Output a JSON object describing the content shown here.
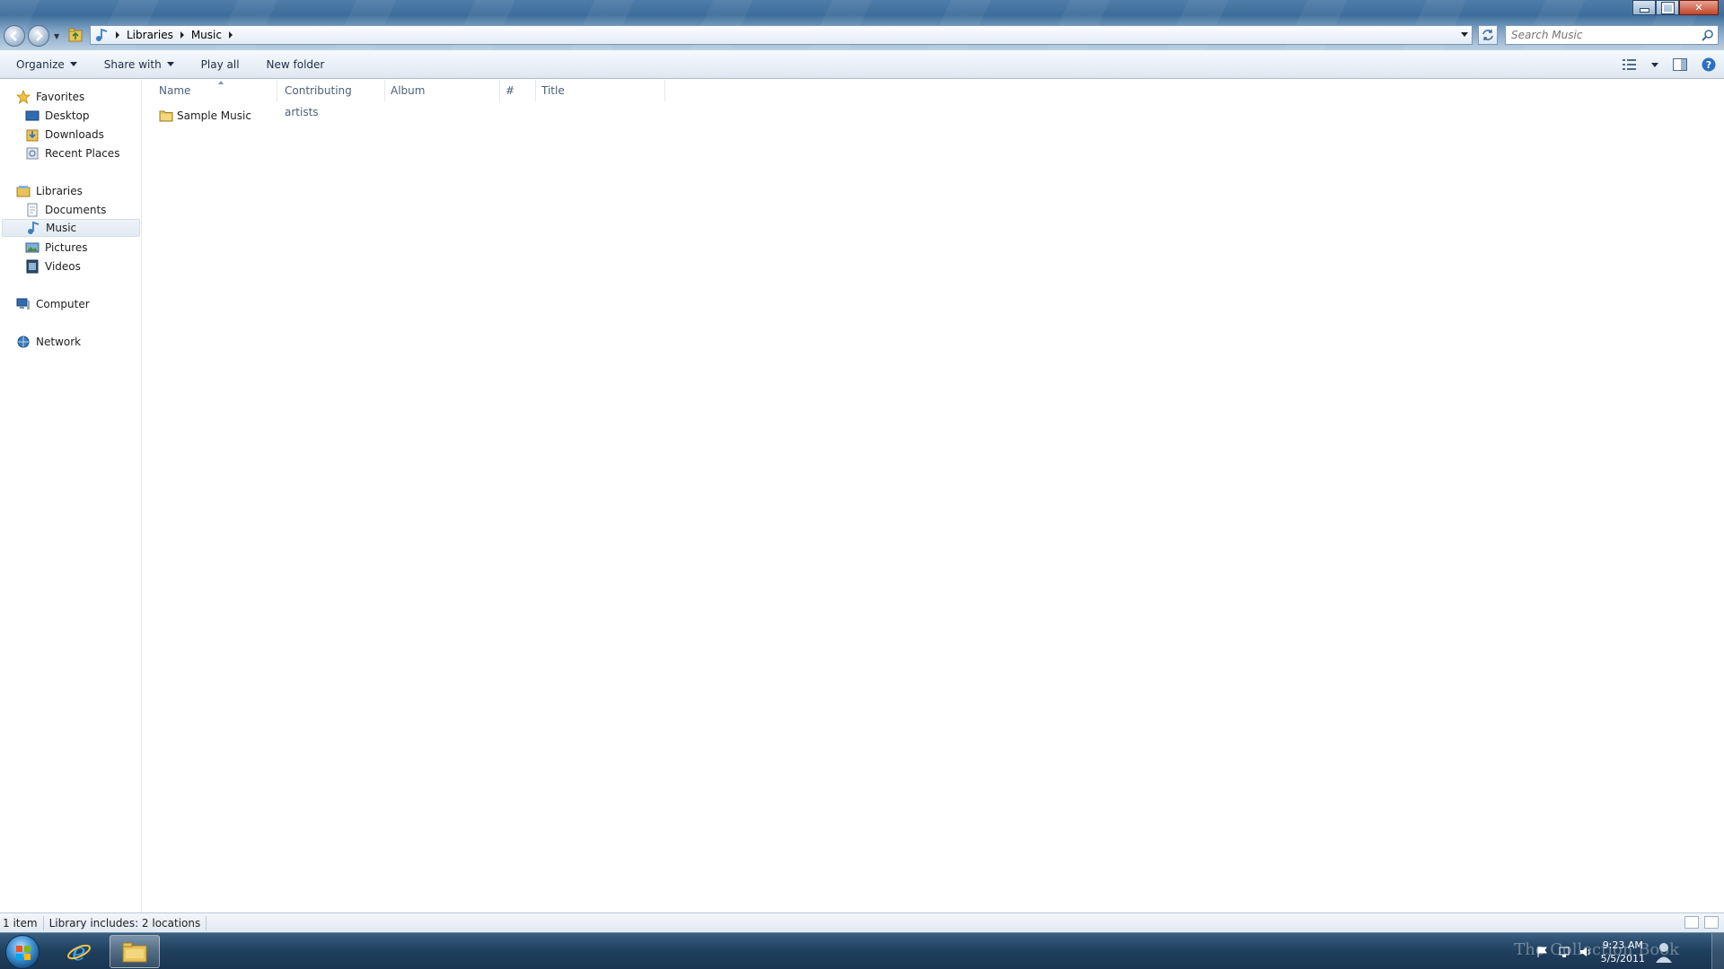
{
  "window": {
    "breadcrumb": [
      "Libraries",
      "Music"
    ],
    "search_placeholder": "Search Music"
  },
  "toolbar": {
    "organize": "Organize",
    "share_with": "Share with",
    "play_all": "Play all",
    "new_folder": "New folder"
  },
  "nav": {
    "favorites": "Favorites",
    "desktop": "Desktop",
    "downloads": "Downloads",
    "recent_places": "Recent Places",
    "libraries": "Libraries",
    "documents": "Documents",
    "music": "Music",
    "pictures": "Pictures",
    "videos": "Videos",
    "computer": "Computer",
    "network": "Network",
    "selected": "Music"
  },
  "columns": [
    "Name",
    "Contributing artists",
    "Album",
    "#",
    "Title"
  ],
  "items": [
    {
      "name": "Sample Music",
      "type": "folder"
    }
  ],
  "status": {
    "item_count": "1 item",
    "library_includes": "Library includes:  2 locations"
  },
  "taskbar": {
    "time": "9:23 AM",
    "date": "5/5/2011",
    "watermark": "The Collection Book"
  },
  "colors": {
    "accent": "#3d6d9b",
    "taskbar": "#1f3f5e",
    "close": "#c1442a"
  }
}
